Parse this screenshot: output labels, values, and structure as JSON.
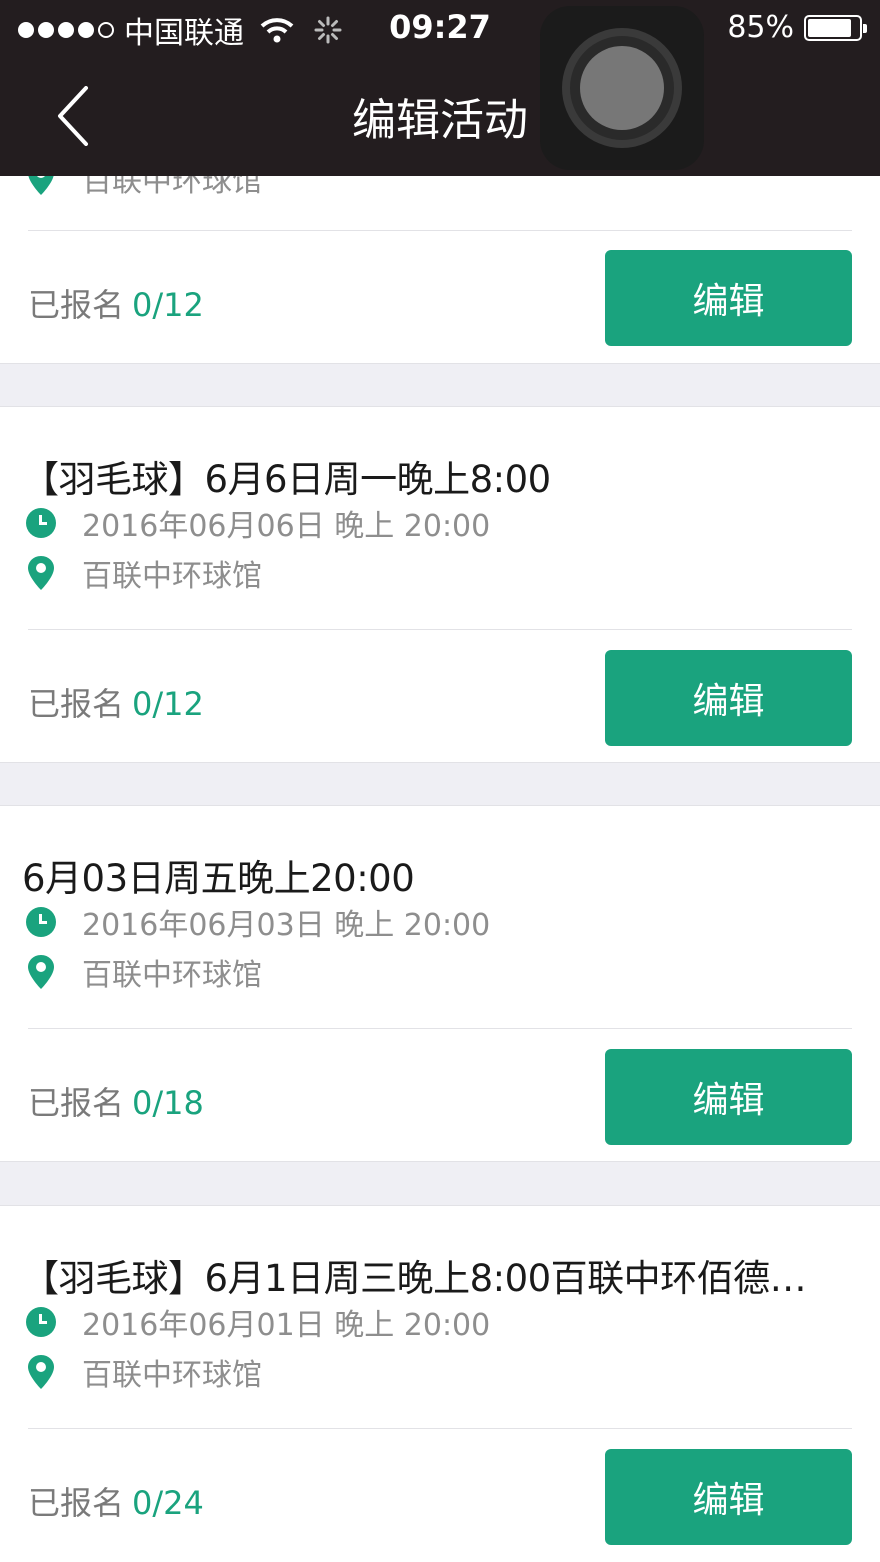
{
  "status_bar": {
    "carrier": "中国联通",
    "time": "09:27",
    "battery": "85%",
    "battery_level": 0.85
  },
  "nav": {
    "title": "编辑活动"
  },
  "partial_card": {
    "location": "百联中环球馆",
    "signup_label": "已报名",
    "signup_count": "0/12",
    "edit_label": "编辑"
  },
  "activities": [
    {
      "title": "【羽毛球】6月6日周一晚上8:00",
      "datetime": "2016年06月06日 晚上 20:00",
      "location": "百联中环球馆",
      "signup_label": "已报名",
      "signup_count": "0/12",
      "edit_label": "编辑"
    },
    {
      "title": "6月03日周五晚上20:00",
      "datetime": "2016年06月03日 晚上 20:00",
      "location": "百联中环球馆",
      "signup_label": "已报名",
      "signup_count": "0/18",
      "edit_label": "编辑"
    },
    {
      "title": "【羽毛球】6月1日周三晚上8:00百联中环佰德…",
      "datetime": "2016年06月01日 晚上 20:00",
      "location": "百联中环球馆",
      "signup_label": "已报名",
      "signup_count": "0/24",
      "edit_label": "编辑"
    }
  ],
  "colors": {
    "accent": "#1aa37e",
    "header_bg": "#231d1f",
    "page_bg": "#efeff4"
  }
}
